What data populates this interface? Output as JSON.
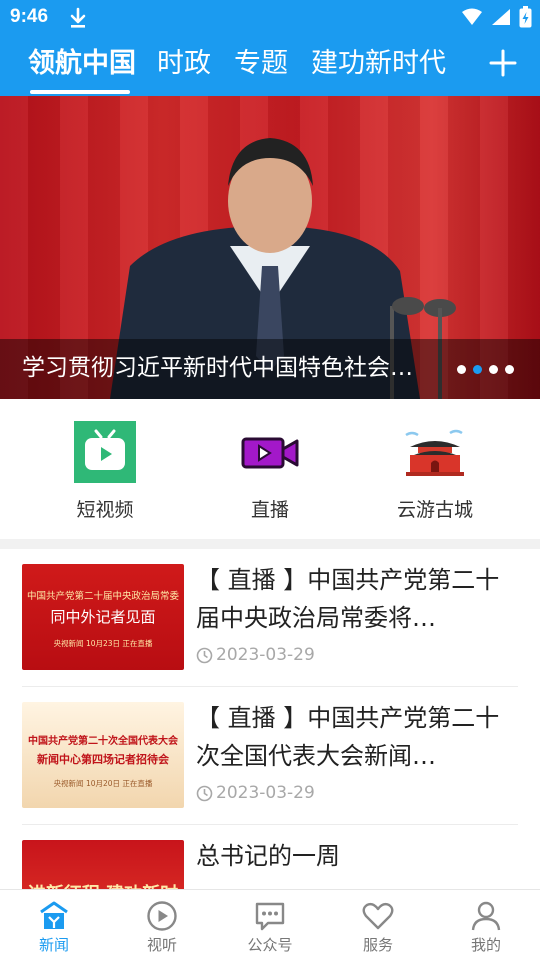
{
  "status_bar": {
    "time": "9:46"
  },
  "tabs": [
    {
      "label": "领航中国",
      "active": true
    },
    {
      "label": "时政",
      "active": false
    },
    {
      "label": "专题",
      "active": false
    },
    {
      "label": "建功新时代",
      "active": false
    }
  ],
  "banner": {
    "caption": "学习贯彻习近平新时代中国特色社会…",
    "slide_count": 4,
    "active_slide": 2
  },
  "quick_entries": [
    {
      "label": "短视频",
      "icon": "tv-icon"
    },
    {
      "label": "直播",
      "icon": "video-camera-icon"
    },
    {
      "label": "云游古城",
      "icon": "gate-tower-icon"
    }
  ],
  "news": [
    {
      "title": "【 直播 】中国共产党第二十届中央政治局常委将…",
      "date": "2023-03-29",
      "thumb_lines": [
        "中国共产党第二十届中央政治局常委",
        "同中外记者见面",
        "央视新闻  10月23日  正在直播"
      ]
    },
    {
      "title": "【 直播 】中国共产党第二十次全国代表大会新闻…",
      "date": "2023-03-29",
      "thumb_lines": [
        "中国共产党第二十次全国代表大会",
        "新闻中心第四场记者招待会",
        "央视新闻  10月20日  正在直播"
      ]
    },
    {
      "title": "总书记的一周",
      "date": "",
      "thumb_lines": [
        "进新征程 建功新时"
      ]
    }
  ],
  "bottom_nav": [
    {
      "label": "新闻",
      "icon": "news-home-icon",
      "active": true
    },
    {
      "label": "视听",
      "icon": "play-circle-icon",
      "active": false
    },
    {
      "label": "公众号",
      "icon": "message-icon",
      "active": false
    },
    {
      "label": "服务",
      "icon": "heart-icon",
      "active": false
    },
    {
      "label": "我的",
      "icon": "user-icon",
      "active": false
    }
  ],
  "colors": {
    "accent": "#1b9bf0",
    "banner_red": "#c71c22"
  }
}
